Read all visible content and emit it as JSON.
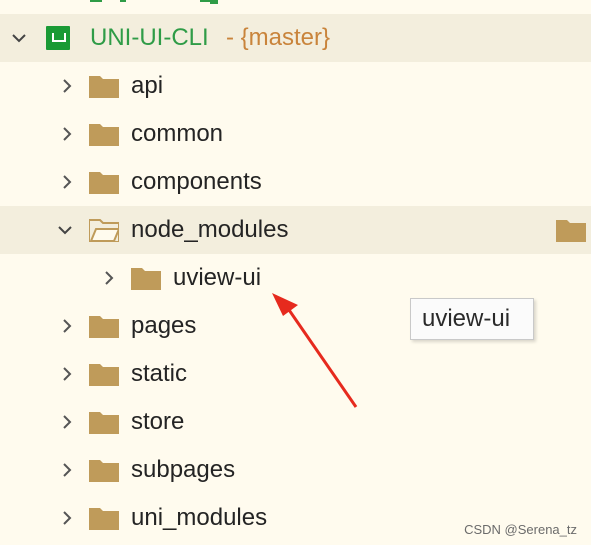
{
  "project": {
    "name": "UNI-UI-CLI",
    "branch": "- {master}"
  },
  "tree": {
    "items": [
      {
        "label": "api",
        "icon": "folder-icon",
        "expanded": false
      },
      {
        "label": "common",
        "icon": "folder-icon",
        "expanded": false
      },
      {
        "label": "components",
        "icon": "folder-icon",
        "expanded": false
      },
      {
        "label": "node_modules",
        "icon": "folder-open-icon",
        "expanded": true
      },
      {
        "label": "uview-ui",
        "icon": "folder-icon",
        "expanded": false
      },
      {
        "label": "pages",
        "icon": "folder-icon",
        "expanded": false
      },
      {
        "label": "static",
        "icon": "folder-icon",
        "expanded": false
      },
      {
        "label": "store",
        "icon": "folder-icon",
        "expanded": false
      },
      {
        "label": "subpages",
        "icon": "folder-icon",
        "expanded": false
      },
      {
        "label": "uni_modules",
        "icon": "folder-icon",
        "expanded": false
      }
    ]
  },
  "tooltip": {
    "text": "uview-ui"
  },
  "watermark": {
    "text": "CSDN @Serena_tz"
  },
  "colors": {
    "background": "#fffbee",
    "selected_row": "#f3eedd",
    "folder": "#bf9b5a",
    "project_icon": "#1a9a35",
    "project_label": "#2f9c47",
    "branch": "#c9843b",
    "annotation_arrow": "#e62a1e"
  }
}
